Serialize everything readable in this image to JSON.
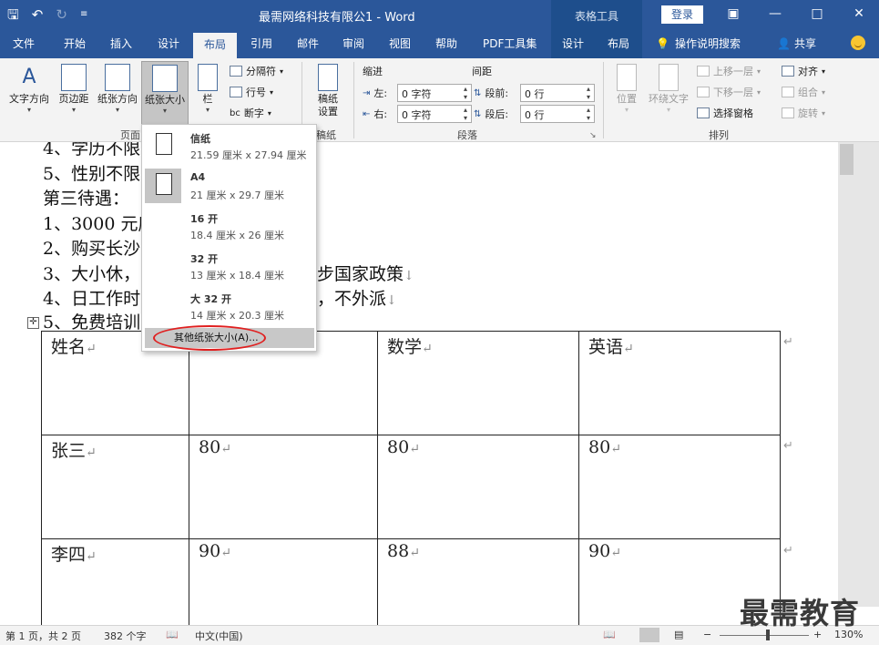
{
  "titlebar": {
    "doc_title": "最需网络科技有限公1  -  Word",
    "context_group": "表格工具",
    "login": "登录"
  },
  "tabs": [
    "文件",
    "开始",
    "插入",
    "设计",
    "布局",
    "引用",
    "邮件",
    "审阅",
    "视图",
    "帮助",
    "PDF工具集"
  ],
  "context_tabs": [
    "设计",
    "布局"
  ],
  "search_label": "操作说明搜索",
  "share_label": "共享",
  "ribbon": {
    "text_direction": "文字方向",
    "margins": "页边距",
    "orientation": "纸张方向",
    "size": "纸张大小",
    "columns": "栏",
    "breaks": "分隔符",
    "line_numbers": "行号",
    "hyphenation": "断字",
    "grid_paper": "稿纸\n设置",
    "grid_paper_line1": "稿纸",
    "grid_paper_line2": "设置",
    "group_page_setup": "页面",
    "group_grid": "稿纸",
    "indent_title": "缩进",
    "spacing_title": "间距",
    "indent_left_label": "左:",
    "indent_left_value": "0 字符",
    "indent_right_label": "右:",
    "indent_right_value": "0 字符",
    "space_before_label": "段前:",
    "space_before_value": "0 行",
    "space_after_label": "段后:",
    "space_after_value": "0 行",
    "group_paragraph": "段落",
    "position": "位置",
    "wrap_text": "环绕文字",
    "bring_forward": "上移一层",
    "send_backward": "下移一层",
    "selection_pane": "选择窗格",
    "align": "对齐",
    "group": "组合",
    "rotate": "旋转",
    "group_arrange": "排列"
  },
  "paper_sizes": [
    {
      "name": "信纸",
      "size": "21.59 厘米 x 27.94 厘米"
    },
    {
      "name": "A4",
      "size": "21 厘米 x 29.7 厘米"
    },
    {
      "name": "16 开",
      "size": "18.4 厘米 x 26 厘米"
    },
    {
      "name": "32 开",
      "size": "13 厘米 x 18.4 厘米"
    },
    {
      "name": "大 32 开",
      "size": "14 厘米 x 20.3 厘米"
    }
  ],
  "more_sizes": "其他纸张大小(A)...",
  "doc_lines": [
    "4、学历不限",
    "5、性别不限",
    "第三待遇：",
    "1、3000 元底",
    "2、购买长沙",
    "3、大小休，",
    "4、日工作时",
    "5、免费培训"
  ],
  "doc_line_tails": {
    "line6": "步国家政策",
    "line7": "，不外派"
  },
  "table": {
    "header": [
      "姓名",
      "",
      "数学",
      "英语"
    ],
    "rows": [
      [
        "张三",
        "80",
        "80",
        "80"
      ],
      [
        "李四",
        "90",
        "88",
        "90"
      ]
    ]
  },
  "status": {
    "page": "第 1 页，共 2 页",
    "words": "382 个字",
    "language": "中文(中国)",
    "zoom": "130%"
  },
  "watermark": "最需教育"
}
